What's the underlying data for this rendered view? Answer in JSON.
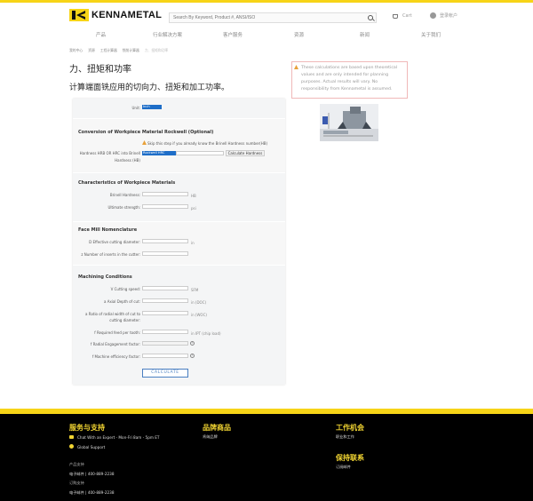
{
  "header": {
    "brand": "KENNAMETAL",
    "search_placeholder": "Search By Keyword, Product #, ANSI/ISO",
    "cart_label": "Cart",
    "account_label": "登录帐户"
  },
  "nav": [
    {
      "label": "产品"
    },
    {
      "label": "行业解决方案"
    },
    {
      "label": "客户服务"
    },
    {
      "label": "资源"
    },
    {
      "label": "新闻"
    },
    {
      "label": "关于我们"
    }
  ],
  "breadcrumb": [
    {
      "label": "我的中心"
    },
    {
      "label": "资源"
    },
    {
      "label": "工程计算器"
    },
    {
      "label": "铣削计算器"
    },
    {
      "label": "力、扭矩和功率"
    }
  ],
  "page": {
    "title": "力、扭矩和功率",
    "subtitle": "计算端面铣应用的切向力、扭矩和加工功率。",
    "notice": "These calculations are based upon theoretical values and are only intended for planning purposes. Actual results will vary. No responsibility from Kennametal is assumed."
  },
  "form": {
    "unit_label": "Unit:",
    "unit_value": "Inch",
    "conversion": {
      "title": "Conversion of Workpiece Material Rockwell (Optional)",
      "skip_note": "Skip this step if you already know the Brinell Hardness number(HB)",
      "hardness_label": "Hardness HRB OR HRC into Brinell Hardness (HB)",
      "select_value": "Rockwell HRC",
      "button": "Calculate Hardness"
    },
    "materials": {
      "title": "Characteristics of Workpiece Materials",
      "brinell_label": "Brinell Hardness:",
      "brinell_unit": "HB",
      "ultimate_label": "Ultimate strength:",
      "ultimate_unit": "psi"
    },
    "nomenclature": {
      "title": "Face Mill Nomenclature",
      "dia_label": "Effective cutting diameter:",
      "dia_prefix": "D",
      "dia_unit": "in",
      "z_label": "Number of inserts in the cutter:",
      "z_prefix": "z"
    },
    "conditions": {
      "title": "Machining Conditions",
      "vc_label": "Cutting speed:",
      "vc_prefix": "V",
      "vc_unit": "SFM",
      "ap_label": "Axial Depth of cut:",
      "ap_prefix": "a",
      "ap_unit": "in (DOC)",
      "ae_label": "Ratio of radial width of cut to cutting diameter:",
      "ae_prefix": "a",
      "ae_unit": "in (WOC)",
      "fz_label": "Required feed per tooth:",
      "fz_prefix": "f",
      "fz_unit": "in IPT (chip load)",
      "kr_label": "Radial Engagement factor:",
      "kr_prefix": "f",
      "eff_label": "Machine efficiency factor:",
      "eff_prefix": "f",
      "help_glyph": "?",
      "calculate": "CALCULATE"
    }
  },
  "footer": {
    "support_title": "服务与支持",
    "chat": "Chat With an Expert - Mon-Fri 8am - 5pm ET",
    "global_support": "Global Support",
    "product_support": "产品支持",
    "phone1": "电子邮件 | 400-889-2238",
    "order_support": "订购支持",
    "phone2": "电子邮件 | 400-889-2238",
    "brands_title": "品牌商品",
    "brands_link": "肯纳品牌",
    "careers_title": "工作机会",
    "careers_link": "职业和工作",
    "contact_title": "保持联系",
    "contact_link": "订阅邮件"
  }
}
